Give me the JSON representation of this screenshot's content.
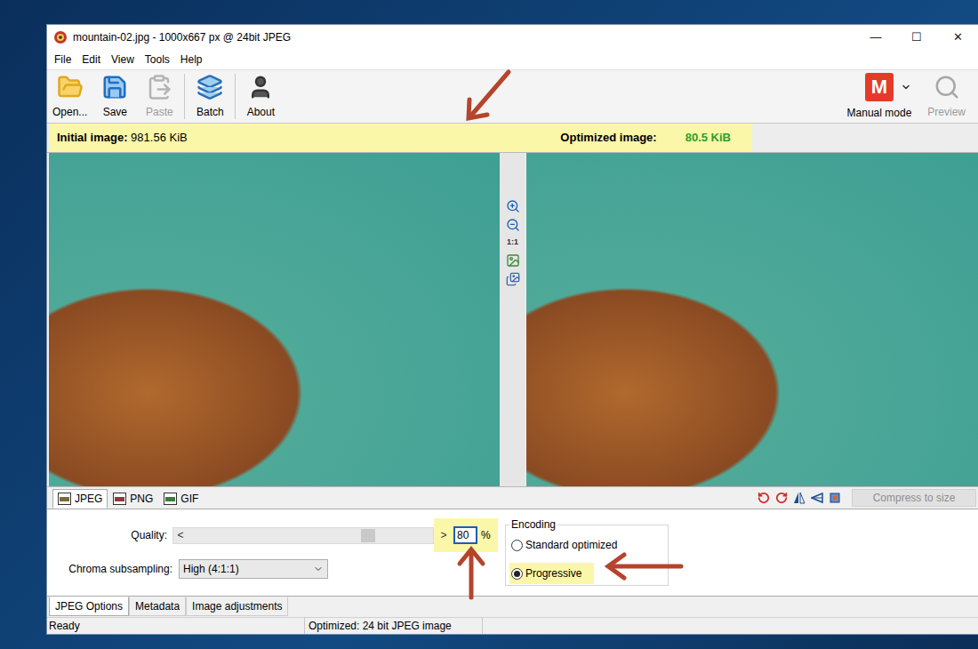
{
  "window": {
    "title": "mountain-02.jpg - 1000x667 px @ 24bit JPEG",
    "controls": [
      "—",
      "☐",
      "✕"
    ]
  },
  "menu": [
    "File",
    "Edit",
    "View",
    "Tools",
    "Help"
  ],
  "toolbar": {
    "buttons": [
      {
        "label": "Open...",
        "disabled": false
      },
      {
        "label": "Save",
        "disabled": false
      },
      {
        "label": "Paste",
        "disabled": true
      },
      {
        "label": "Batch",
        "disabled": false
      },
      {
        "label": "About",
        "disabled": false
      }
    ],
    "mode": {
      "badge": "M",
      "label": "Manual mode"
    },
    "preview": {
      "label": "Preview",
      "disabled": true
    }
  },
  "info": {
    "initial_label": "Initial image:",
    "initial_value": "981.56 KiB",
    "optimized_label": "Optimized image:",
    "optimized_value": "80.5 KiB",
    "highlighted": true
  },
  "viewer": {
    "zoom_label": "1:1"
  },
  "format_tabs": [
    {
      "label": "JPEG",
      "selected": true
    },
    {
      "label": "PNG",
      "selected": false
    },
    {
      "label": "GIF",
      "selected": false
    }
  ],
  "compress_to_size": {
    "label": "Compress to size",
    "disabled": true
  },
  "quality": {
    "label": "Quality:",
    "left_arrow": "<",
    "right_arrow": ">",
    "value": "80",
    "unit": "%",
    "level": 0.78,
    "highlighted": true
  },
  "chroma": {
    "label": "Chroma subsampling:",
    "value": "High (4:1:1)"
  },
  "encoding": {
    "title": "Encoding",
    "options": [
      {
        "label": "Standard optimized",
        "selected": false,
        "highlighted": false
      },
      {
        "label": "Progressive",
        "selected": true,
        "highlighted": true
      }
    ]
  },
  "option_tabs": [
    {
      "label": "JPEG Options",
      "selected": true
    },
    {
      "label": "Metadata",
      "selected": false
    },
    {
      "label": "Image adjustments",
      "selected": false
    }
  ],
  "status_bar": [
    "Ready",
    "Optimized: 24 bit JPEG image"
  ]
}
